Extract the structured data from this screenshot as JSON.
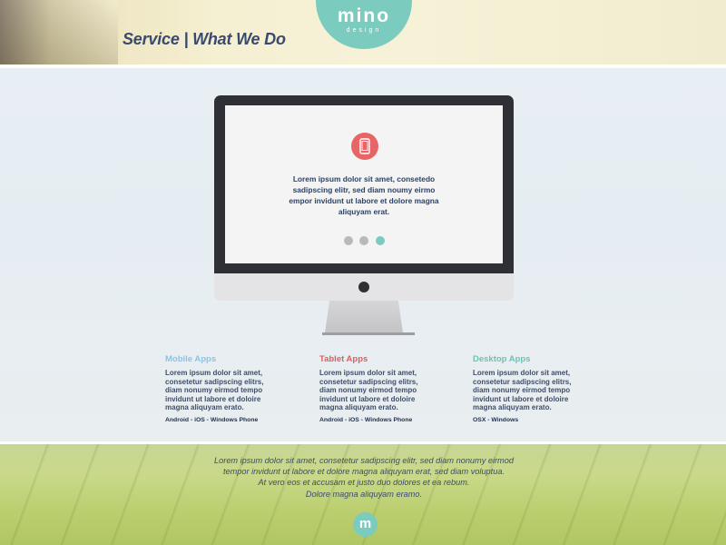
{
  "header": {
    "title": "Service | What We Do",
    "logo": {
      "main": "mino",
      "sub": "design"
    }
  },
  "slider": {
    "icon": "tablet-icon",
    "text": "Lorem ipsum dolor sit amet, consetedo sadipscing elitr, sed diam noumy eirmo empor invidunt ut labore et dolore magna aliquyam erat.",
    "dots": 3,
    "active_dot": 3
  },
  "services": [
    {
      "title": "Mobile Apps",
      "color": "#8cc3e8",
      "text": "Lorem ipsum dolor sit amet, consetetur sadipscing elitrs, diam nonumy eirmod tempo invidunt ut labore et doloire magna aliquyam erato.",
      "platforms": "Android - iOS - Windows Phone"
    },
    {
      "title": "Tablet Apps",
      "color": "#e45a5c",
      "text": "Lorem ipsum dolor sit amet, consetetur sadipscing elitrs, diam nonumy eirmod tempo invidunt ut labore et doloire magna aliquyam erato.",
      "platforms": "Android - iOS - Windows Phone"
    },
    {
      "title": "Desktop Apps",
      "color": "#6cc4b4",
      "text": "Lorem ipsum dolor sit amet, consetetur sadipscing elitrs, diam nonumy eirmod tempo invidunt ut labore et doloire magna aliquyam erato.",
      "platforms": "OSX - Windows"
    }
  ],
  "footer": {
    "lines": [
      "Lorem ipsum dolor sit amet, consetetur sadipscing elitr, sed diam nonumy eirmod",
      "tempor invidunt ut labore et dolore magna aliquyam erat, sed diam voluptua.",
      "At vero eos et accusam et justo duo dolores et ea rebum.",
      "Dolore magna aliquyam eramo."
    ],
    "logo_letter": "m"
  },
  "colors": {
    "accent": "#7ccbbf",
    "title": "#3a4a6e",
    "tablet_icon_bg": "#e76467"
  }
}
